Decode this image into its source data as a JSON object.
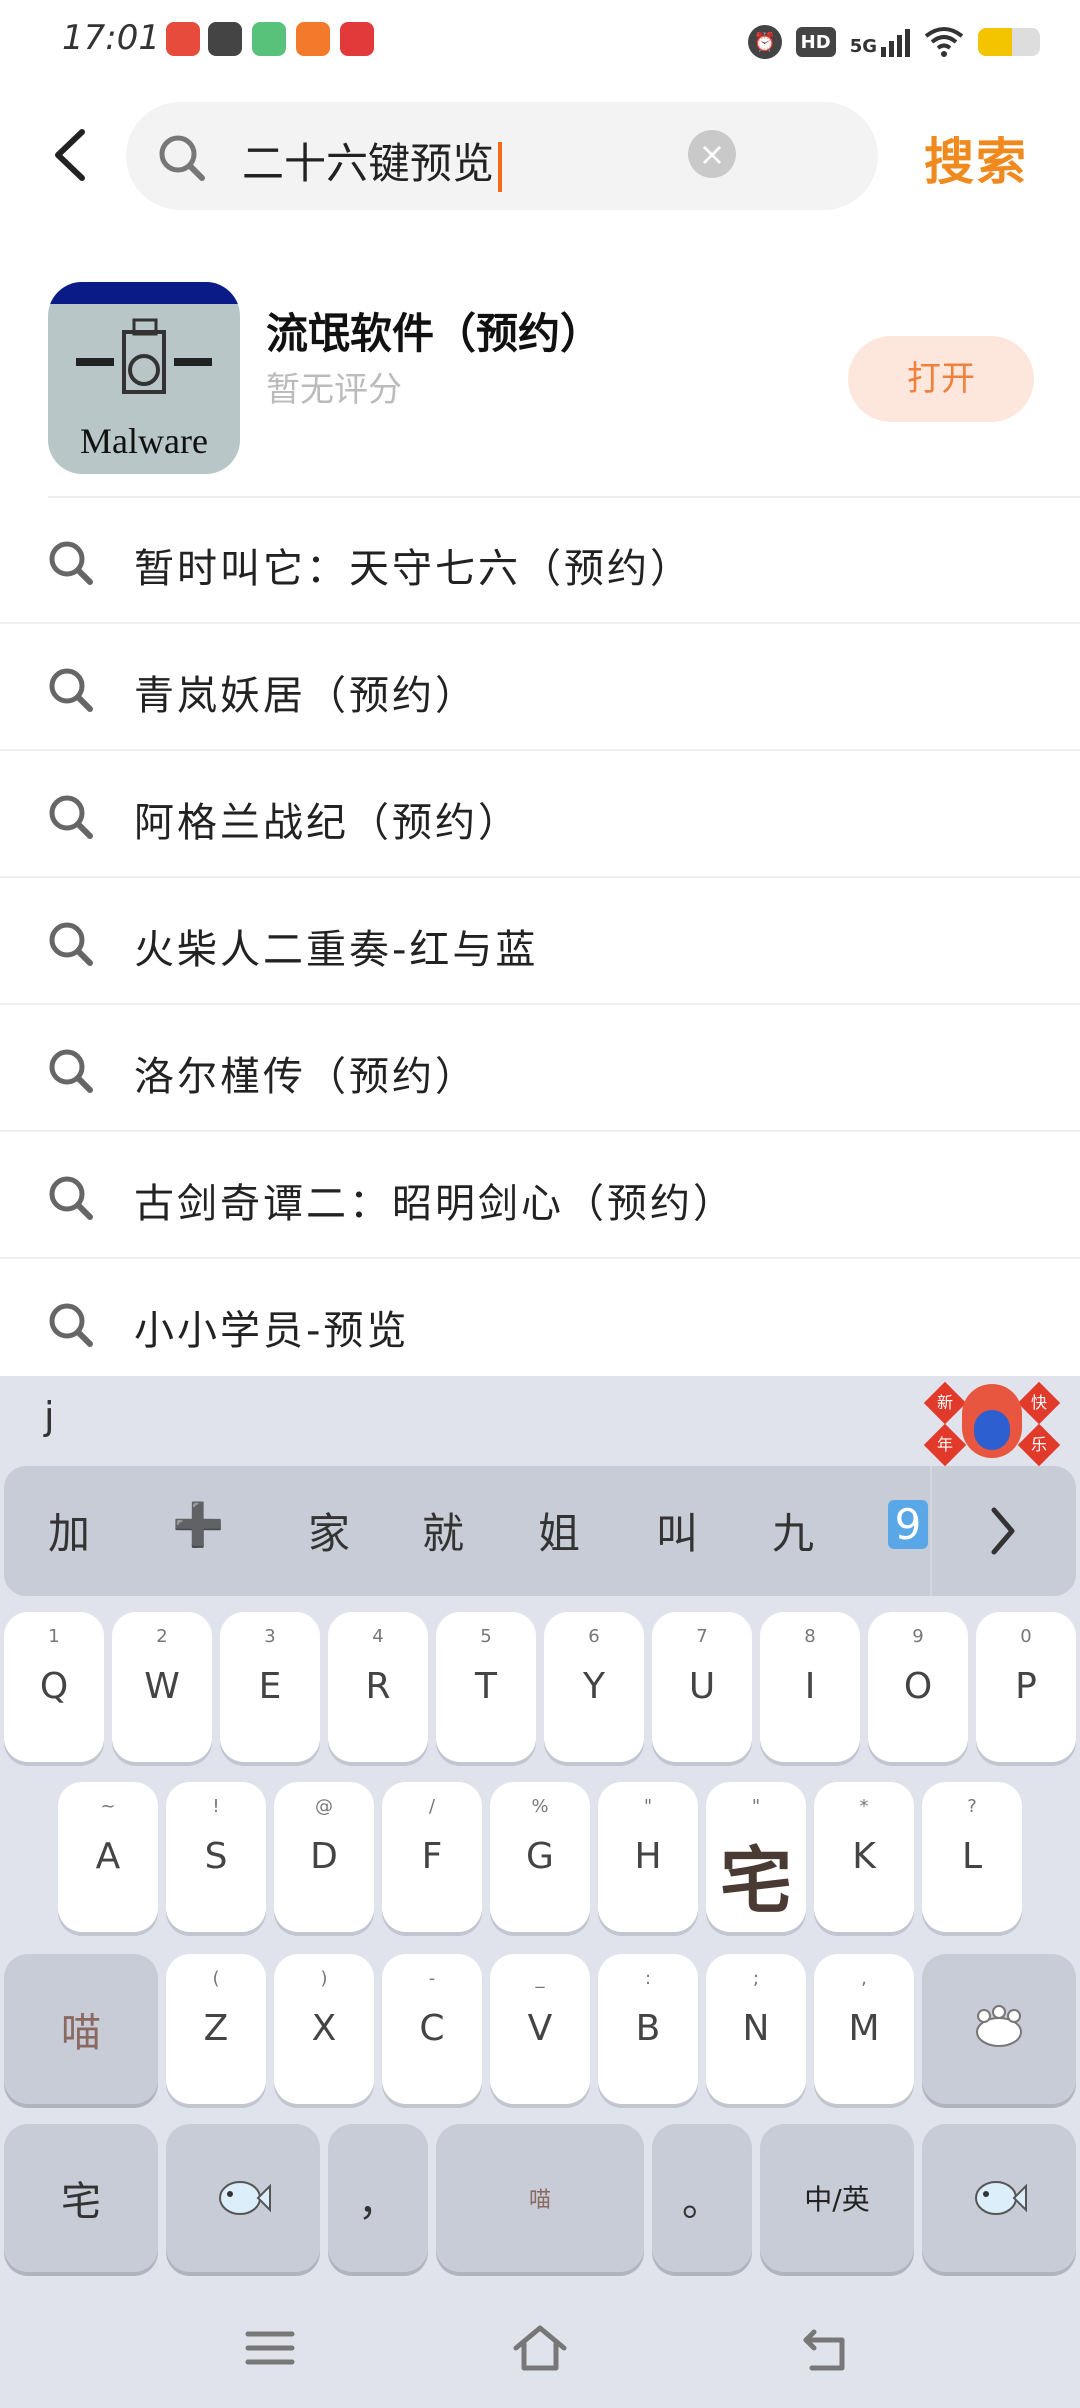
{
  "status_bar": {
    "time": "17:01",
    "network_badge": "HD",
    "network_type": "5G",
    "battery_percent": 55,
    "app_icon_colors": [
      "#e64b3c",
      "#444444",
      "#58c27a",
      "#f27a2a",
      "#e23a3a"
    ]
  },
  "search": {
    "query": "二十六键预览",
    "submit_label": "搜索",
    "icons": {
      "back": "back-arrow-icon",
      "search": "search-icon",
      "clear": "clear-icon"
    }
  },
  "app_result": {
    "name": "流氓软件（预约）",
    "rating": "暂无评分",
    "action_label": "打开",
    "icon_text": "Malware"
  },
  "suggestions": [
    "暂时叫它：天守七六（预约）",
    "青岚妖居（预约）",
    "阿格兰战纪（预约）",
    "火柴人二重奏-红与蓝",
    "洛尔槿传（预约）",
    "古剑奇谭二：昭明剑心（预约）",
    "小小学员-预览"
  ],
  "keyboard": {
    "composing": "j",
    "sticker_labels": [
      "新",
      "快",
      "年",
      "乐"
    ],
    "candidates": [
      "加",
      "➕",
      "家",
      "就",
      "姐",
      "叫",
      "九",
      "9"
    ],
    "row1": [
      {
        "hint": "1",
        "key": "Q"
      },
      {
        "hint": "2",
        "key": "W"
      },
      {
        "hint": "3",
        "key": "E"
      },
      {
        "hint": "4",
        "key": "R"
      },
      {
        "hint": "5",
        "key": "T"
      },
      {
        "hint": "6",
        "key": "Y"
      },
      {
        "hint": "7",
        "key": "U"
      },
      {
        "hint": "8",
        "key": "I"
      },
      {
        "hint": "9",
        "key": "O"
      },
      {
        "hint": "0",
        "key": "P"
      }
    ],
    "row2": [
      {
        "hint": "~",
        "key": "A"
      },
      {
        "hint": "!",
        "key": "S"
      },
      {
        "hint": "@",
        "key": "D"
      },
      {
        "hint": "/",
        "key": "F"
      },
      {
        "hint": "%",
        "key": "G"
      },
      {
        "hint": "\"",
        "key": "H"
      },
      {
        "hint": "\"",
        "key": "宅"
      },
      {
        "hint": "*",
        "key": "K"
      },
      {
        "hint": "?",
        "key": "L"
      }
    ],
    "row3_left": "喵",
    "row3": [
      {
        "hint": "(",
        "key": "Z"
      },
      {
        "hint": ")",
        "key": "X"
      },
      {
        "hint": "-",
        "key": "C"
      },
      {
        "hint": "_",
        "key": "V"
      },
      {
        "hint": ":",
        "key": "B"
      },
      {
        "hint": ";",
        "key": "N"
      },
      {
        "hint": ",",
        "key": "M"
      }
    ],
    "row3_right_icon": "paw-backspace-icon",
    "row4": {
      "left": "宅",
      "emoji_icon": "fish-emoji-icon",
      "comma": "，",
      "space": "喵",
      "period": "。",
      "lang": "中/英",
      "enter_icon": "fish-enter-icon"
    }
  },
  "nav_bar": {
    "icons": [
      "menu-icon",
      "home-icon",
      "back-icon"
    ]
  }
}
